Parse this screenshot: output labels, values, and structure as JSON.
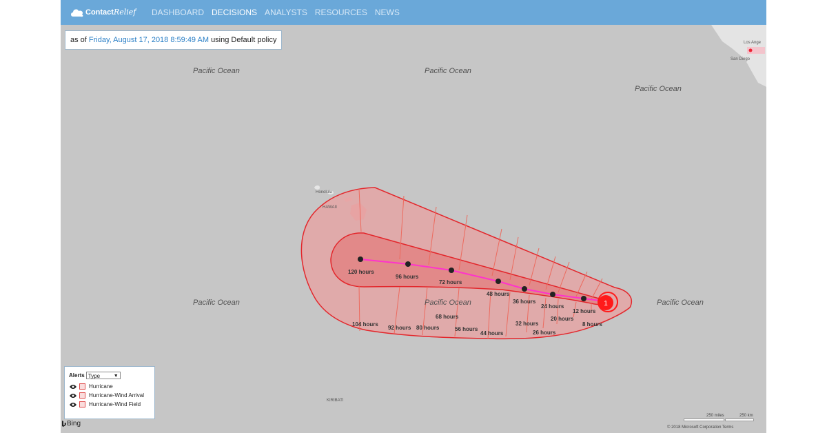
{
  "nav": {
    "logo_main": "Contact",
    "logo_script": "Relief",
    "items": [
      {
        "label": "DASHBOARD",
        "active": false
      },
      {
        "label": "DECISIONS",
        "active": true
      },
      {
        "label": "ANALYSTS",
        "active": false
      },
      {
        "label": "RESOURCES",
        "active": false
      },
      {
        "label": "NEWS",
        "active": false
      }
    ]
  },
  "asof": {
    "prefix": "as of",
    "datetime": "Friday, August 17, 2018 8:59:49 AM",
    "suffix": "using Default policy"
  },
  "map": {
    "oceans": [
      "Pacific Ocean",
      "Pacific Ocean",
      "Pacific Ocean",
      "Pacific Ocean",
      "Pacific Ocean",
      "Pacific Ocean"
    ],
    "places": {
      "los_angeles": "Los Ange",
      "san_diego": "San Diego",
      "honolulu": "Honolulu",
      "hawaii": "HAWAII",
      "kiribati": "KIRIBATI"
    },
    "storm_label": "1",
    "forecast_labels": [
      "120 hours",
      "96 hours",
      "72 hours",
      "48 hours",
      "36 hours",
      "24 hours",
      "12 hours"
    ],
    "arrival_labels": [
      "104 hours",
      "92 hours",
      "80 hours",
      "68 hours",
      "56 hours",
      "44 hours",
      "32 hours",
      "26 hours",
      "20 hours",
      "8 hours"
    ],
    "colors": {
      "cone_outer": "#e8a0a0",
      "cone_inner": "#e28585",
      "cone_stroke": "#e3262b",
      "track": "#ff33cc",
      "storm": "#ff1a1a"
    }
  },
  "legend": {
    "title": "Alerts",
    "select_value": "Type",
    "items": [
      "Hurricane",
      "Hurricane-Wind Arrival",
      "Hurricane-Wind Field"
    ]
  },
  "footer": {
    "bing": "Bing",
    "scale_miles": "250 miles",
    "scale_km": "250 km",
    "copyright": "© 2018 Microsoft Corporation",
    "terms": "Terms"
  }
}
